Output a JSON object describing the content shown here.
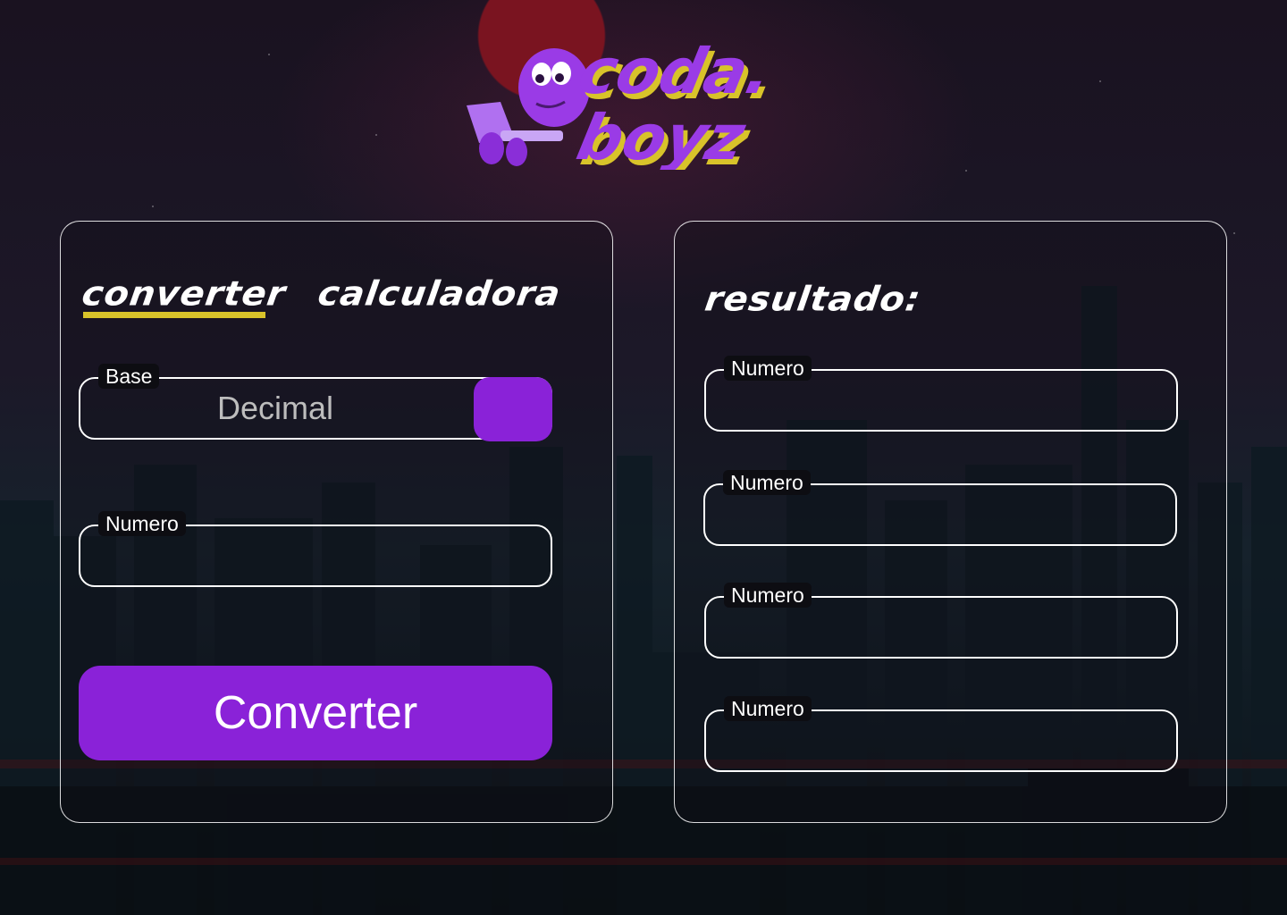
{
  "brand": {
    "line1": "coda.",
    "line2": "boyz"
  },
  "tabs": {
    "converter": "converter",
    "calculator": "calculadora"
  },
  "converter_form": {
    "base_label": "Base",
    "base_value": "Decimal",
    "number_label": "Numero",
    "number_value": "",
    "submit_label": "Converter"
  },
  "result_panel": {
    "title": "resultado:",
    "fields": [
      {
        "label": "Numero",
        "value": ""
      },
      {
        "label": "Numero",
        "value": ""
      },
      {
        "label": "Numero",
        "value": ""
      },
      {
        "label": "Numero",
        "value": ""
      }
    ]
  },
  "colors": {
    "accent": "#8a22d8",
    "underline": "#d8c32a",
    "logo_purple": "#9a3be6",
    "logo_yellow": "#d8c32a"
  }
}
